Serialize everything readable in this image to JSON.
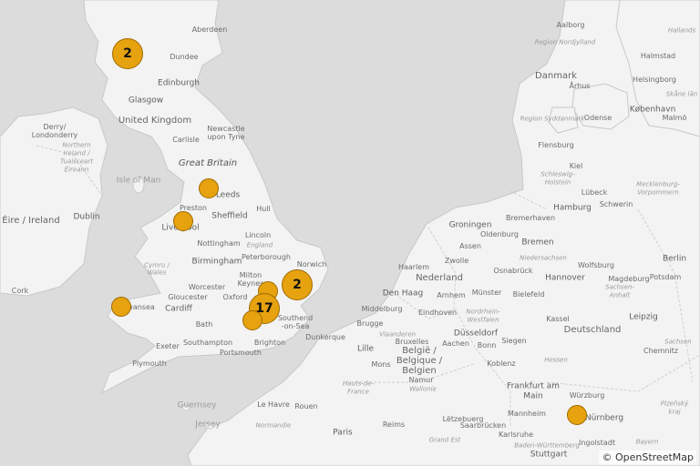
{
  "map": {
    "attribution": "© OpenStreetMap",
    "labels": {
      "aberdeen": "Aberdeen",
      "dundee": "Dundee",
      "edinburgh": "Edinburgh",
      "glasgow": "Glasgow",
      "united_kingdom": "United Kingdom",
      "derry": "Derry/",
      "londonderry": "Londonderry",
      "northern_ireland_1": "Northern",
      "northern_ireland_2": "Ireland /",
      "northern_ireland_3": "Tuaisceart",
      "northern_ireland_4": "Éireann",
      "carlisle": "Carlisle",
      "newcastle_1": "Newcastle",
      "newcastle_2": "upon Tyne",
      "great_britain": "Great Britain",
      "isle_of_man": "Isle of Man",
      "eire": "Éire / Ireland",
      "dublin": "Dublin",
      "leeds": "Leeds",
      "preston": "Preston",
      "sheffield": "Sheffield",
      "hull": "Hull",
      "liverpool": "Liverpool",
      "nottingham": "Nottingham",
      "lincoln": "Lincoln",
      "england": "England",
      "peterborough": "Peterborough",
      "norwich": "Norwich",
      "cymru": "Cymru /",
      "wales": "Wales",
      "birmingham": "Birmingham",
      "cork": "Cork",
      "milton_1": "Milton",
      "milton_2": "Keynes",
      "worcester": "Worcester",
      "gloucester": "Gloucester",
      "oxford": "Oxford",
      "swansea": "Swansea",
      "cardiff": "Cardiff",
      "bath": "Bath",
      "southend_1": "Southend",
      "southend_2": "-on-Sea",
      "exeter": "Exeter",
      "southampton": "Southampton",
      "brighton": "Brighton",
      "portsmouth": "Portsmouth",
      "plymouth": "Plymouth",
      "guernsey": "Guernsey",
      "jersey": "Jersey",
      "le_havre": "Le Havre",
      "normandie": "Normandie",
      "rouen": "Rouen",
      "paris": "Paris",
      "reims": "Reims",
      "grand_est": "Grand Est",
      "hauts_de_france_1": "Hauts-de-",
      "hauts_de_france_2": "France",
      "dunkerque": "Dunkerque",
      "lille": "Lille",
      "belgie_1": "België /",
      "belgie_2": "Belgique /",
      "belgie_3": "Belgien",
      "mons": "Mons",
      "namur": "Namur",
      "bruxelles": "Bruxelles",
      "brugge": "Brugge",
      "middelburg": "Middelburg",
      "vlaanderen": "Vlaanderen",
      "wallonie": "Wallonie",
      "den_haag": "Den Haag",
      "haarlem": "Haarlem",
      "nederland": "Nederland",
      "arnhem": "Arnhem",
      "eindhoven": "Eindhoven",
      "zwolle": "Zwolle",
      "assen": "Assen",
      "groningen": "Groningen",
      "luxembourg": "Lëtzebuerg",
      "saarbrucken": "Saarbrücken",
      "aachen": "Aachen",
      "bonn": "Bonn",
      "koblenz": "Koblenz",
      "dusseldorf": "Düsseldorf",
      "nrw_1": "Nordrhein-",
      "nrw_2": "Westfalen",
      "munster": "Münster",
      "bielefeld": "Bielefeld",
      "osnabruck": "Osnabrück",
      "oldenburg": "Oldenburg",
      "bremen": "Bremen",
      "bremerhaven": "Bremerhaven",
      "niedersachsen": "Niedersachsen",
      "hannover": "Hannover",
      "kassel": "Kassel",
      "siegen": "Siegen",
      "frankfurt_1": "Frankfurt am",
      "frankfurt_2": "Main",
      "mannheim": "Mannheim",
      "karlsruhe": "Karlsruhe",
      "stuttgart": "Stuttgart",
      "bw": "Baden-Württemberg",
      "wurzburg": "Würzburg",
      "nurnberg": "Nürnberg",
      "ingolstadt": "Ingolstadt",
      "bayern": "Bayern",
      "deutschland": "Deutschland",
      "hessen": "Hessen",
      "leipzig": "Leipzig",
      "chemnitz": "Chemnitz",
      "sachsen_1": "Sachsen",
      "sachsen_anhalt_1": "Sachsen-",
      "sachsen_anhalt_2": "Anhalt",
      "wolfsburg": "Wolfsburg",
      "magdeburg": "Magdeburg",
      "berlin": "Berlin",
      "potsdam": "Potsdam",
      "hamburg": "Hamburg",
      "lubeck": "Lübeck",
      "schwerin": "Schwerin",
      "mv_1": "Mecklenburg-",
      "mv_2": "Vorpommern",
      "sh_1": "Schleswig-",
      "sh_2": "Holstein",
      "kiel": "Kiel",
      "flensburg": "Flensburg",
      "danmark": "Danmark",
      "aalborg": "Aalborg",
      "region_nord_1": "Region Nordjylland",
      "arhus": "Århus",
      "odense": "Odense",
      "region_syd": "Region Syddanmark",
      "kobenhavn": "København",
      "halmstad": "Halmstad",
      "helsingborg": "Helsingborg",
      "malmo": "Malmö",
      "skane": "Skåne län",
      "hallands": "Hallands",
      "plzen_1": "Plzeňský",
      "plzen_2": "kraj"
    },
    "markers": [
      {
        "kind": "cluster",
        "count": "2",
        "place": "Scottish Highlands"
      },
      {
        "kind": "point",
        "count": "",
        "place": "Leeds area"
      },
      {
        "kind": "point",
        "count": "",
        "place": "Liverpool area"
      },
      {
        "kind": "cluster",
        "count": "2",
        "place": "East of England"
      },
      {
        "kind": "point",
        "count": "",
        "place": "Oxford area"
      },
      {
        "kind": "cluster",
        "count": "17",
        "place": "London"
      },
      {
        "kind": "point",
        "count": "",
        "place": "Southampton area"
      },
      {
        "kind": "point",
        "count": "",
        "place": "Pembrokeshire"
      },
      {
        "kind": "point",
        "count": "",
        "place": "Nürnberg area"
      }
    ]
  }
}
